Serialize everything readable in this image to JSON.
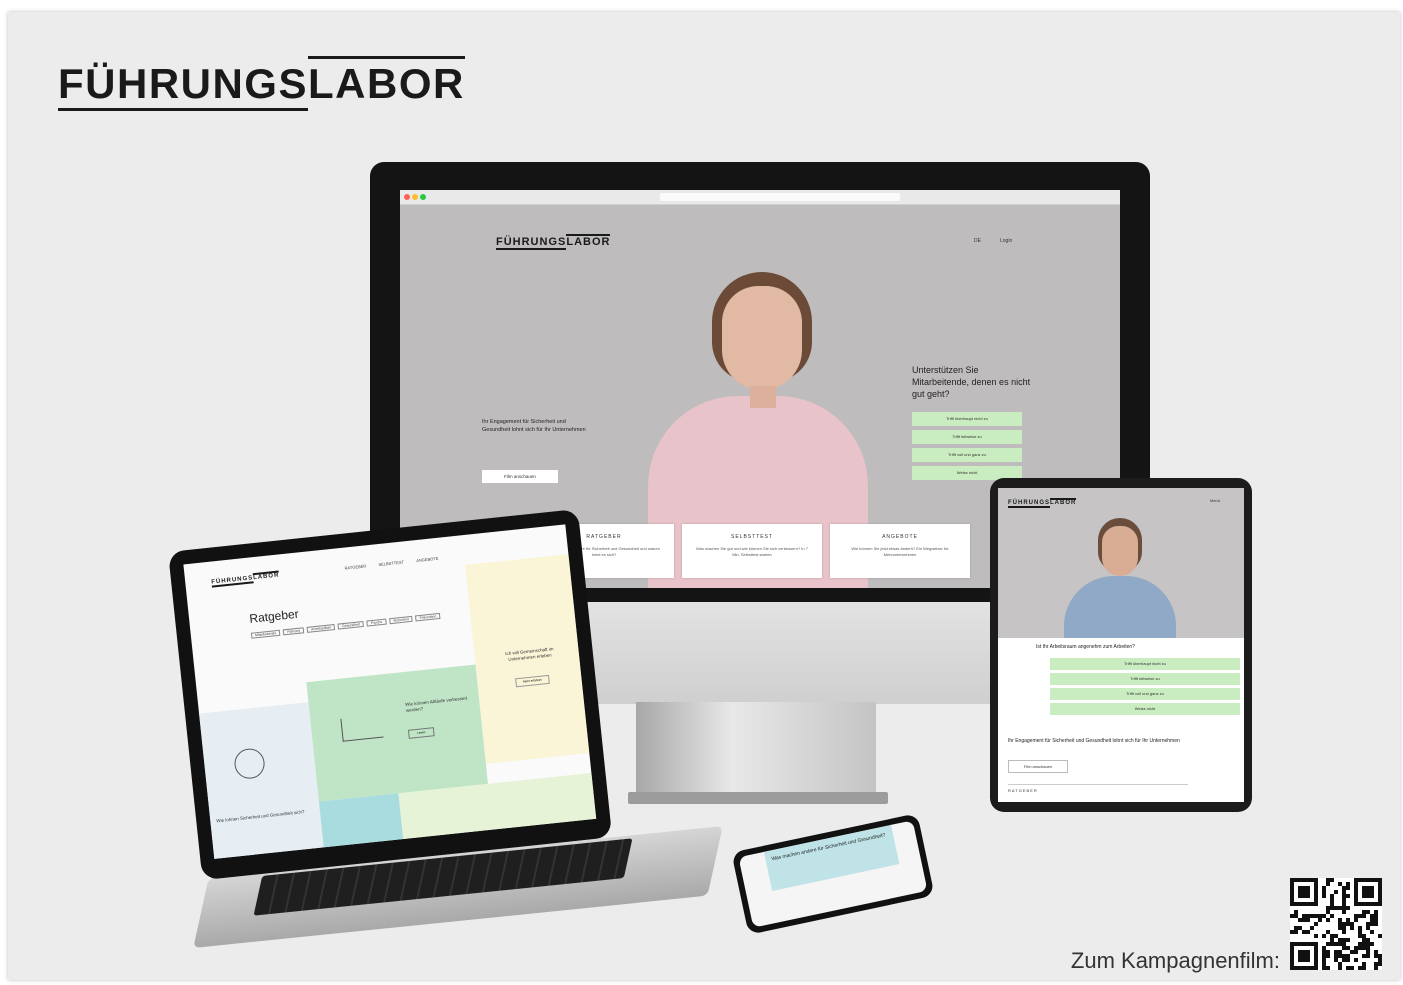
{
  "brand": {
    "part1": "FÜHRUNGS",
    "part2": "LABOR"
  },
  "monitor": {
    "nav_lang": "DE",
    "nav_login": "Login",
    "hero_left_text": "Ihr Engagement für Sicherheit und Gesundheit lohnt sich für Ihr Unternehmen",
    "hero_left_button": "Film anschauen",
    "hero_question": "Unterstützen Sie Mitarbeitende, denen es nicht gut geht?",
    "answers": [
      "Trifft überhaupt nicht zu",
      "Trifft teilweise zu",
      "Trifft voll und ganz zu",
      "Weiss nicht"
    ],
    "cards": [
      {
        "title": "RATGEBER",
        "text": "Was machen andere für Sicherheit und Gesundheit und warum lohnt es sich?"
      },
      {
        "title": "SELBSTTEST",
        "text": "Was machen Sie gut und wie können Sie sich verbessern? In 7 Min. Selbsttest starten"
      },
      {
        "title": "ANGEBOTE",
        "text": "Wie können Sie jetzt etwas ändern? Ein Wegweiser für Mehrunternehmen"
      }
    ]
  },
  "tablet": {
    "menu": "Menü",
    "question": "Ist Ihr Arbeitsraum angenehm zum Arbeiten?",
    "answers": [
      "Trifft überhaupt nicht zu",
      "Trifft teilweise zu",
      "Trifft voll und ganz zu",
      "Weiss nicht"
    ],
    "engagement_text": "Ihr Engagement für Sicherheit und Gesundheit lohnt sich für Ihr Unternehmen",
    "button": "Film anschauen",
    "section": "RATGEBER"
  },
  "laptop": {
    "nav_items": [
      "RATGEBER",
      "SELBSTTEST",
      "ANGEBOTE"
    ],
    "page_title": "Ratgeber",
    "tags": [
      "Mitarbeitende",
      "Führung",
      "Arbeitsplätze",
      "Gesundheit",
      "Psyche",
      "Sicherheit",
      "Prävention"
    ],
    "tile1_text": "Wie können Abläufe verbessert werden?",
    "tile1_button": "Lesen",
    "tile2_text": "Ich will Gemeinschaft im Unternehmen erleben",
    "tile2_button": "Mehr erfahren",
    "tile3_text": "Wie lohnen Sicherheit und Gesundheit sich?"
  },
  "phone": {
    "headline": "Was machen andere für Sicherheit und Gesundheit?"
  },
  "caption": "Zum Kampagnenfilm:",
  "colors": {
    "accent_green": "#c9ecc0",
    "background": "#ececec",
    "hero_gray": "#bfbcbd"
  }
}
